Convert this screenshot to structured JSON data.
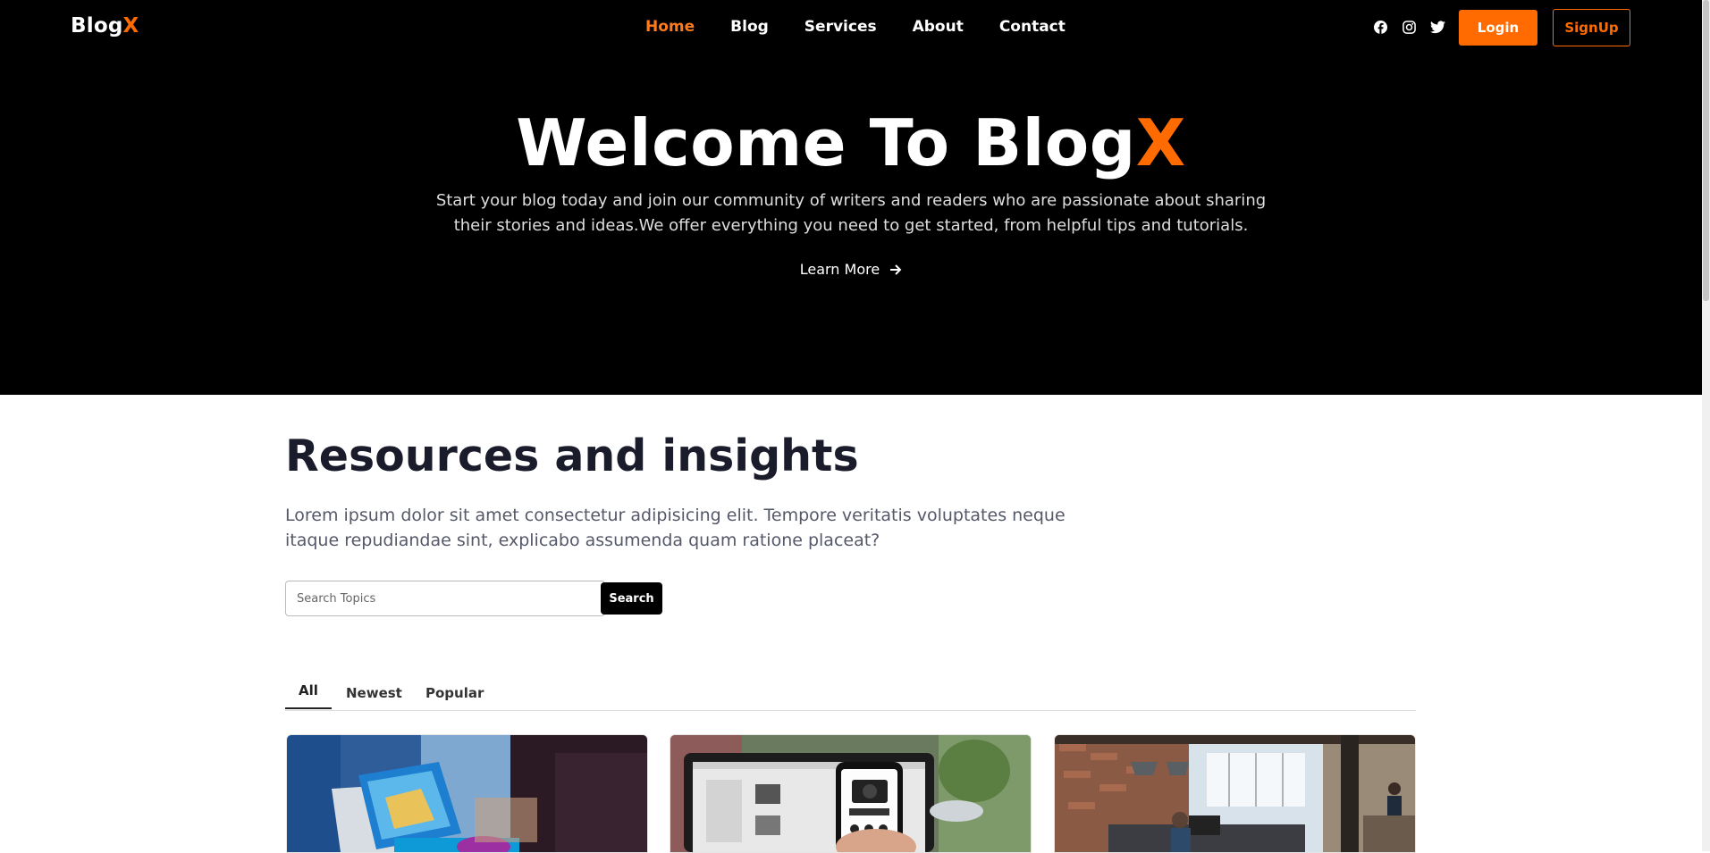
{
  "brand": {
    "name": "Blog",
    "accent_letter": "X",
    "accent_color": "#ff6b00"
  },
  "nav": {
    "items": [
      "Home",
      "Blog",
      "Services",
      "About",
      "Contact"
    ],
    "active": "Home"
  },
  "social_icons": [
    "facebook-icon",
    "instagram-icon",
    "twitter-icon"
  ],
  "auth": {
    "login_label": "Login",
    "signup_label": "SignUp"
  },
  "hero": {
    "title_prefix": "Welcome To Blog",
    "title_accent": "X",
    "subtitle": "Start your blog today and join our community of writers and readers who are passionate about sharing their stories and ideas.We offer everything you need to get started, from helpful tips and tutorials.",
    "cta_label": "Learn More"
  },
  "resources": {
    "title": "Resources and insights",
    "description": "Lorem ipsum dolor sit amet consectetur adipisicing elit. Tempore veritatis voluptates neque itaque repudiandae sint, explicabo assumenda quam ratione placeat?"
  },
  "search": {
    "placeholder": "Search Topics",
    "button_label": "Search"
  },
  "tabs": {
    "items": [
      "All",
      "Newest",
      "Popular"
    ],
    "active": "All"
  },
  "cards": [
    {
      "image": "laptop-tablet-photo"
    },
    {
      "image": "phone-camera-shopping-photo"
    },
    {
      "image": "office-workspace-photo"
    }
  ]
}
